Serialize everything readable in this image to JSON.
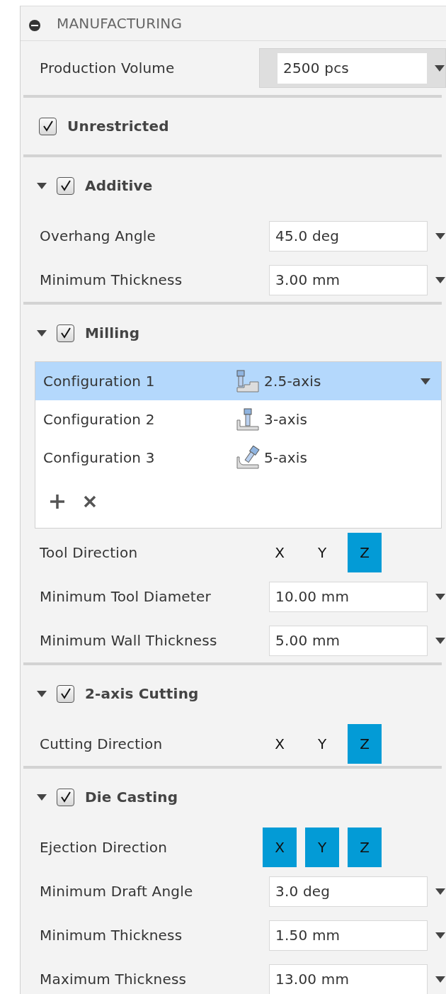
{
  "header": {
    "title": "MANUFACTURING",
    "expanded": true
  },
  "production_volume": {
    "label": "Production Volume",
    "value": "2500 pcs"
  },
  "sections": [
    {
      "kind": "plain",
      "title": "Unrestricted",
      "checked": true
    },
    {
      "kind": "group",
      "title": "Additive",
      "checked": true,
      "expanded": true,
      "rows": [
        {
          "kind": "field",
          "label": "Overhang Angle",
          "value": "45.0 deg"
        },
        {
          "kind": "field",
          "label": "Minimum Thickness",
          "value": "3.00 mm"
        }
      ]
    },
    {
      "kind": "group",
      "title": "Milling",
      "checked": true,
      "expanded": true,
      "configurations": [
        {
          "name": "Configuration 1",
          "type": "2.5-axis",
          "selected": true
        },
        {
          "name": "Configuration 2",
          "type": "3-axis",
          "selected": false
        },
        {
          "name": "Configuration 3",
          "type": "5-axis",
          "selected": false
        }
      ],
      "rows": [
        {
          "kind": "axes",
          "label": "Tool Direction",
          "axes": [
            {
              "label": "X",
              "selected": false
            },
            {
              "label": "Y",
              "selected": false
            },
            {
              "label": "Z",
              "selected": true
            }
          ]
        },
        {
          "kind": "field",
          "label": "Minimum Tool Diameter",
          "value": "10.00 mm"
        },
        {
          "kind": "field",
          "label": "Minimum Wall Thickness",
          "value": "5.00 mm"
        }
      ]
    },
    {
      "kind": "group",
      "title": "2-axis Cutting",
      "checked": true,
      "expanded": true,
      "rows": [
        {
          "kind": "axes",
          "label": "Cutting Direction",
          "axes": [
            {
              "label": "X",
              "selected": false
            },
            {
              "label": "Y",
              "selected": false
            },
            {
              "label": "Z",
              "selected": true
            }
          ]
        }
      ]
    },
    {
      "kind": "group",
      "title": "Die Casting",
      "checked": true,
      "expanded": true,
      "rows": [
        {
          "kind": "axes",
          "label": "Ejection Direction",
          "axes": [
            {
              "label": "X",
              "selected": true
            },
            {
              "label": "Y",
              "selected": true
            },
            {
              "label": "Z",
              "selected": true
            }
          ]
        },
        {
          "kind": "field",
          "label": "Minimum Draft Angle",
          "value": "3.0 deg"
        },
        {
          "kind": "field",
          "label": "Minimum Thickness",
          "value": "1.50 mm"
        },
        {
          "kind": "field",
          "label": "Maximum Thickness",
          "value": "13.00 mm"
        }
      ]
    }
  ]
}
